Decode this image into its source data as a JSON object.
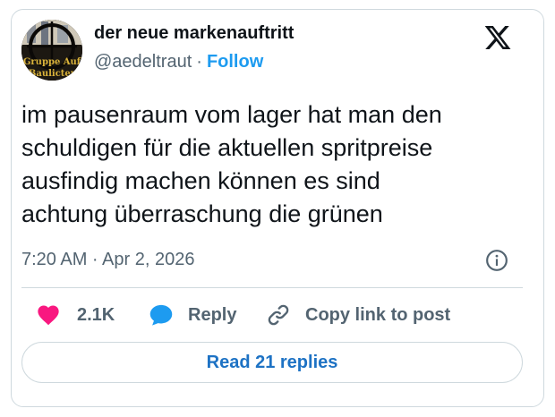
{
  "author": {
    "display_name": "der neue markenauftritt",
    "handle": "@aedeltraut",
    "separator": "·",
    "follow_label": "Follow",
    "avatar_text_line1": "Gruppe Auf",
    "avatar_text_line2": "Baulicter"
  },
  "tweet": {
    "lines": [
      "im pausenraum vom lager hat man den",
      "schuldigen für die aktuellen spritpreise",
      "ausfindig machen können es sind",
      "achtung überraschung die grünen"
    ],
    "timestamp": "7:20 AM · Apr 2, 2026"
  },
  "actions": {
    "like_count": "2.1K",
    "reply_label": "Reply",
    "copy_link_label": "Copy link to post"
  },
  "footer": {
    "read_replies_label": "Read 21 replies"
  },
  "icons": {
    "brand": "x-logo-icon",
    "info": "info-icon",
    "like": "heart-icon",
    "reply": "speech-bubble-icon",
    "copy": "link-icon"
  },
  "colors": {
    "accent": "#1d9bf0",
    "reply_button_text": "#1d72c4",
    "like": "#f91880",
    "reply_icon": "#1d9bf0",
    "muted": "#536471",
    "border": "#cfd9de"
  }
}
